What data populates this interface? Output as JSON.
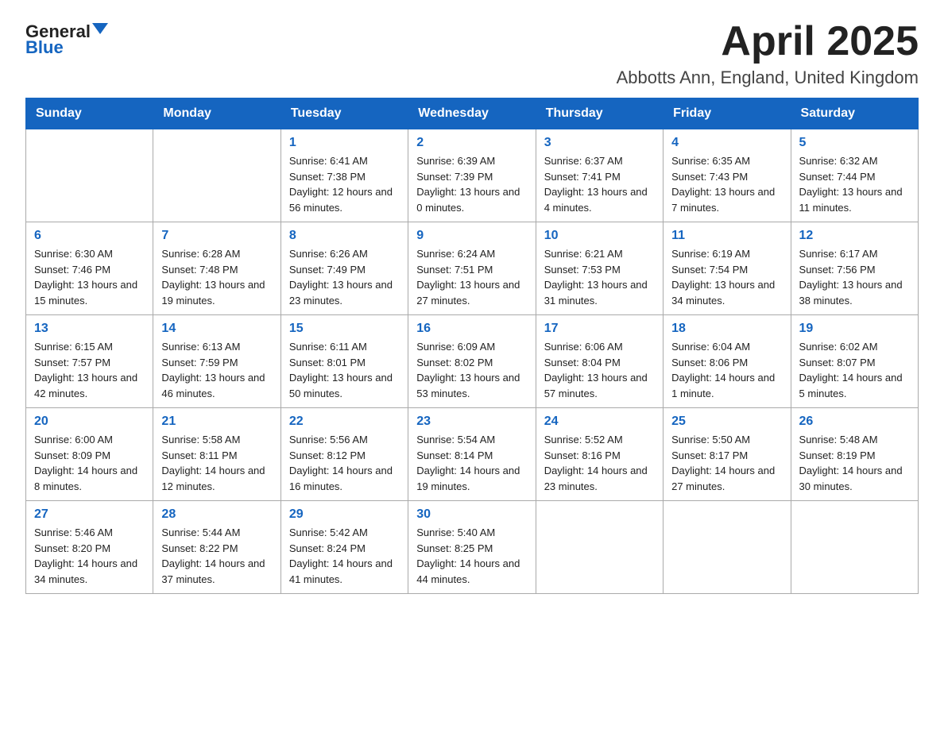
{
  "logo": {
    "text_general": "General",
    "text_blue": "Blue"
  },
  "header": {
    "month": "April 2025",
    "location": "Abbotts Ann, England, United Kingdom"
  },
  "weekdays": [
    "Sunday",
    "Monday",
    "Tuesday",
    "Wednesday",
    "Thursday",
    "Friday",
    "Saturday"
  ],
  "weeks": [
    [
      {
        "day": "",
        "sunrise": "",
        "sunset": "",
        "daylight": ""
      },
      {
        "day": "",
        "sunrise": "",
        "sunset": "",
        "daylight": ""
      },
      {
        "day": "1",
        "sunrise": "Sunrise: 6:41 AM",
        "sunset": "Sunset: 7:38 PM",
        "daylight": "Daylight: 12 hours and 56 minutes."
      },
      {
        "day": "2",
        "sunrise": "Sunrise: 6:39 AM",
        "sunset": "Sunset: 7:39 PM",
        "daylight": "Daylight: 13 hours and 0 minutes."
      },
      {
        "day": "3",
        "sunrise": "Sunrise: 6:37 AM",
        "sunset": "Sunset: 7:41 PM",
        "daylight": "Daylight: 13 hours and 4 minutes."
      },
      {
        "day": "4",
        "sunrise": "Sunrise: 6:35 AM",
        "sunset": "Sunset: 7:43 PM",
        "daylight": "Daylight: 13 hours and 7 minutes."
      },
      {
        "day": "5",
        "sunrise": "Sunrise: 6:32 AM",
        "sunset": "Sunset: 7:44 PM",
        "daylight": "Daylight: 13 hours and 11 minutes."
      }
    ],
    [
      {
        "day": "6",
        "sunrise": "Sunrise: 6:30 AM",
        "sunset": "Sunset: 7:46 PM",
        "daylight": "Daylight: 13 hours and 15 minutes."
      },
      {
        "day": "7",
        "sunrise": "Sunrise: 6:28 AM",
        "sunset": "Sunset: 7:48 PM",
        "daylight": "Daylight: 13 hours and 19 minutes."
      },
      {
        "day": "8",
        "sunrise": "Sunrise: 6:26 AM",
        "sunset": "Sunset: 7:49 PM",
        "daylight": "Daylight: 13 hours and 23 minutes."
      },
      {
        "day": "9",
        "sunrise": "Sunrise: 6:24 AM",
        "sunset": "Sunset: 7:51 PM",
        "daylight": "Daylight: 13 hours and 27 minutes."
      },
      {
        "day": "10",
        "sunrise": "Sunrise: 6:21 AM",
        "sunset": "Sunset: 7:53 PM",
        "daylight": "Daylight: 13 hours and 31 minutes."
      },
      {
        "day": "11",
        "sunrise": "Sunrise: 6:19 AM",
        "sunset": "Sunset: 7:54 PM",
        "daylight": "Daylight: 13 hours and 34 minutes."
      },
      {
        "day": "12",
        "sunrise": "Sunrise: 6:17 AM",
        "sunset": "Sunset: 7:56 PM",
        "daylight": "Daylight: 13 hours and 38 minutes."
      }
    ],
    [
      {
        "day": "13",
        "sunrise": "Sunrise: 6:15 AM",
        "sunset": "Sunset: 7:57 PM",
        "daylight": "Daylight: 13 hours and 42 minutes."
      },
      {
        "day": "14",
        "sunrise": "Sunrise: 6:13 AM",
        "sunset": "Sunset: 7:59 PM",
        "daylight": "Daylight: 13 hours and 46 minutes."
      },
      {
        "day": "15",
        "sunrise": "Sunrise: 6:11 AM",
        "sunset": "Sunset: 8:01 PM",
        "daylight": "Daylight: 13 hours and 50 minutes."
      },
      {
        "day": "16",
        "sunrise": "Sunrise: 6:09 AM",
        "sunset": "Sunset: 8:02 PM",
        "daylight": "Daylight: 13 hours and 53 minutes."
      },
      {
        "day": "17",
        "sunrise": "Sunrise: 6:06 AM",
        "sunset": "Sunset: 8:04 PM",
        "daylight": "Daylight: 13 hours and 57 minutes."
      },
      {
        "day": "18",
        "sunrise": "Sunrise: 6:04 AM",
        "sunset": "Sunset: 8:06 PM",
        "daylight": "Daylight: 14 hours and 1 minute."
      },
      {
        "day": "19",
        "sunrise": "Sunrise: 6:02 AM",
        "sunset": "Sunset: 8:07 PM",
        "daylight": "Daylight: 14 hours and 5 minutes."
      }
    ],
    [
      {
        "day": "20",
        "sunrise": "Sunrise: 6:00 AM",
        "sunset": "Sunset: 8:09 PM",
        "daylight": "Daylight: 14 hours and 8 minutes."
      },
      {
        "day": "21",
        "sunrise": "Sunrise: 5:58 AM",
        "sunset": "Sunset: 8:11 PM",
        "daylight": "Daylight: 14 hours and 12 minutes."
      },
      {
        "day": "22",
        "sunrise": "Sunrise: 5:56 AM",
        "sunset": "Sunset: 8:12 PM",
        "daylight": "Daylight: 14 hours and 16 minutes."
      },
      {
        "day": "23",
        "sunrise": "Sunrise: 5:54 AM",
        "sunset": "Sunset: 8:14 PM",
        "daylight": "Daylight: 14 hours and 19 minutes."
      },
      {
        "day": "24",
        "sunrise": "Sunrise: 5:52 AM",
        "sunset": "Sunset: 8:16 PM",
        "daylight": "Daylight: 14 hours and 23 minutes."
      },
      {
        "day": "25",
        "sunrise": "Sunrise: 5:50 AM",
        "sunset": "Sunset: 8:17 PM",
        "daylight": "Daylight: 14 hours and 27 minutes."
      },
      {
        "day": "26",
        "sunrise": "Sunrise: 5:48 AM",
        "sunset": "Sunset: 8:19 PM",
        "daylight": "Daylight: 14 hours and 30 minutes."
      }
    ],
    [
      {
        "day": "27",
        "sunrise": "Sunrise: 5:46 AM",
        "sunset": "Sunset: 8:20 PM",
        "daylight": "Daylight: 14 hours and 34 minutes."
      },
      {
        "day": "28",
        "sunrise": "Sunrise: 5:44 AM",
        "sunset": "Sunset: 8:22 PM",
        "daylight": "Daylight: 14 hours and 37 minutes."
      },
      {
        "day": "29",
        "sunrise": "Sunrise: 5:42 AM",
        "sunset": "Sunset: 8:24 PM",
        "daylight": "Daylight: 14 hours and 41 minutes."
      },
      {
        "day": "30",
        "sunrise": "Sunrise: 5:40 AM",
        "sunset": "Sunset: 8:25 PM",
        "daylight": "Daylight: 14 hours and 44 minutes."
      },
      {
        "day": "",
        "sunrise": "",
        "sunset": "",
        "daylight": ""
      },
      {
        "day": "",
        "sunrise": "",
        "sunset": "",
        "daylight": ""
      },
      {
        "day": "",
        "sunrise": "",
        "sunset": "",
        "daylight": ""
      }
    ]
  ]
}
